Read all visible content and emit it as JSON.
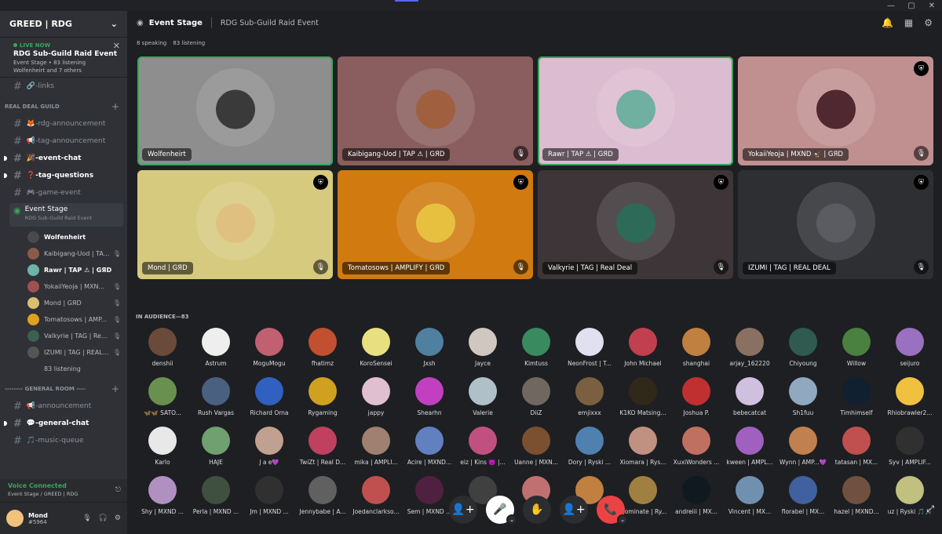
{
  "window": {
    "controls": [
      "—",
      "▢",
      "✕"
    ]
  },
  "guild": {
    "name": "GREED | RDG"
  },
  "live": {
    "tag": "LIVE NOW",
    "title": "RDG Sub-Guild Raid Event",
    "sub": "Event Stage • 83 listening",
    "others": "Wolfenheirt and 7 others"
  },
  "channels_top": [
    {
      "label": "🔗-links"
    }
  ],
  "categories": {
    "real_deal": "REAL DEAL GUILD",
    "general": "-------- GENERAL ROOM ----"
  },
  "channels_rdg": [
    {
      "label": "🦊-rdg-announcement",
      "unread": false
    },
    {
      "label": "📢-tag-announcement",
      "unread": false
    },
    {
      "label": "🎉-event-chat",
      "unread": true
    },
    {
      "label": "❓-tag-questions",
      "unread": true
    },
    {
      "label": "🎮-game-event",
      "unread": false
    }
  ],
  "stage": {
    "name": "Event Stage",
    "sub": "RDG Sub-Guild Raid Event"
  },
  "stage_members": [
    {
      "name": "Wolfenheirt",
      "color": "#4a4a4a",
      "active": true,
      "muted": false
    },
    {
      "name": "Kaibigang-Uod | TA...",
      "color": "#8b5a4a",
      "active": false,
      "muted": true
    },
    {
      "name": "Rawr | TAP ⚠ | GЯD",
      "color": "#6fb3a8",
      "active": true,
      "muted": false
    },
    {
      "name": "YokaiiYeoja | MXN...",
      "color": "#a05050",
      "active": false,
      "muted": true
    },
    {
      "name": "Mond | GЯD",
      "color": "#d8c070",
      "active": false,
      "muted": true
    },
    {
      "name": "Tomatosows | AMP...",
      "color": "#e0a020",
      "active": false,
      "muted": true
    },
    {
      "name": "Valkyrie | TAG | Re...",
      "color": "#3a6050",
      "active": false,
      "muted": true
    },
    {
      "name": "IZUMI | TAG | REAL...",
      "color": "#555",
      "active": false,
      "muted": true
    },
    {
      "name": "83 listening",
      "color": "#2f3136",
      "active": false,
      "muted": false
    }
  ],
  "channels_general": [
    {
      "label": "📢-announcement",
      "unread": false
    },
    {
      "label": "💬-general-chat",
      "unread": true
    },
    {
      "label": "🎵-music-queue",
      "unread": false
    }
  ],
  "voice": {
    "title": "Voice Connected",
    "sub": "Event Stage / GREED | RDG"
  },
  "user": {
    "name": "Mond",
    "disc": "#5964"
  },
  "header": {
    "title": "Event Stage",
    "subtitle": "RDG Sub-Guild Raid Event"
  },
  "stats": {
    "speaking": "8 speaking",
    "listening": "83 listening"
  },
  "speakers": [
    {
      "name": "Wolfenheirt",
      "bg": "#8e8e8e",
      "av": "#3a3a3a",
      "speaking": true,
      "mod": false,
      "muted": false
    },
    {
      "name": "Kaibigang-Uod | TAP ⚠ | GЯD",
      "bg": "#8a5e5e",
      "av": "#a06040",
      "speaking": false,
      "mod": false,
      "muted": true
    },
    {
      "name": "Rawr | TAP ⚠ | GЯD",
      "bg": "#dcbcd0",
      "av": "#70b0a0",
      "speaking": true,
      "mod": false,
      "muted": false
    },
    {
      "name": "YokaiiYeoja | MXND 🦅 | GЯD",
      "bg": "#c09090",
      "av": "#502830",
      "speaking": false,
      "mod": true,
      "muted": true
    },
    {
      "name": "Mond | GЯD",
      "bg": "#d6ca7e",
      "av": "#e0c080",
      "speaking": false,
      "mod": true,
      "muted": true
    },
    {
      "name": "Tomatosows | AMPLIFY | GЯD",
      "bg": "#d07a10",
      "av": "#e8c040",
      "speaking": false,
      "mod": true,
      "muted": true
    },
    {
      "name": "Valkyrie | TAG | Real Deal",
      "bg": "#3d3537",
      "av": "#2e6a58",
      "speaking": false,
      "mod": true,
      "muted": true
    },
    {
      "name": "IZUMI | TAG | REAL DEAL",
      "bg": "#2e2f33",
      "av": "#5a5c62",
      "speaking": false,
      "mod": true,
      "muted": true
    }
  ],
  "audience_title": "IN AUDIENCE—83",
  "audience": [
    {
      "n": "denshii",
      "c": "#6a4a3a"
    },
    {
      "n": "Astrum",
      "c": "#eeeeee"
    },
    {
      "n": "MoguMogu",
      "c": "#c06070"
    },
    {
      "n": "fhatimz",
      "c": "#c05030"
    },
    {
      "n": "KoroSensei",
      "c": "#e8e080"
    },
    {
      "n": "Jxsh",
      "c": "#5080a0"
    },
    {
      "n": "Jayce",
      "c": "#d0c8c0"
    },
    {
      "n": "Kimtuss",
      "c": "#3a8a60"
    },
    {
      "n": "NeonFrost | T...",
      "c": "#e0e0f0"
    },
    {
      "n": "John Michael",
      "c": "#c04050"
    },
    {
      "n": "shanghai",
      "c": "#c08040"
    },
    {
      "n": "arjay_162220",
      "c": "#8a7060"
    },
    {
      "n": "Chiyoung",
      "c": "#305a50"
    },
    {
      "n": "Willow",
      "c": "#4a8040"
    },
    {
      "n": "seijuro",
      "c": "#9a70c0"
    },
    {
      "n": "🦋🦋 SATO...",
      "c": "#6a9050"
    },
    {
      "n": "Rush Vargas",
      "c": "#4a6080"
    },
    {
      "n": "Richard Orna",
      "c": "#3060c0"
    },
    {
      "n": "Rygaming",
      "c": "#d0a020"
    },
    {
      "n": "jappy",
      "c": "#e0c0d0"
    },
    {
      "n": "Shearhn",
      "c": "#c040c0"
    },
    {
      "n": "Valerie",
      "c": "#b0c0c8"
    },
    {
      "n": "DiiZ",
      "c": "#706860"
    },
    {
      "n": "emjixxx",
      "c": "#7a6040"
    },
    {
      "n": "K1KO Matsing...",
      "c": "#302818"
    },
    {
      "n": "Joshua P.",
      "c": "#c03030"
    },
    {
      "n": "bebecatcat",
      "c": "#d0c0e0"
    },
    {
      "n": "Sh1fuu",
      "c": "#90a8c0"
    },
    {
      "n": "Timhimself",
      "c": "#102030"
    },
    {
      "n": "Rhiobrawler2...",
      "c": "#f0c040"
    },
    {
      "n": "Karlo",
      "c": "#e8e8e8"
    },
    {
      "n": "HAJE",
      "c": "#70a070"
    },
    {
      "n": "J a e💜",
      "c": "#c0a090"
    },
    {
      "n": "TwiZt | Real D...",
      "c": "#c04060"
    },
    {
      "n": "mika | AMPLI...",
      "c": "#a08070"
    },
    {
      "n": "Acire | MXND...",
      "c": "#6080c0"
    },
    {
      "n": "eiz | Kins 👿 |...",
      "c": "#c05080"
    },
    {
      "n": "Uanne | MXN...",
      "c": "#7a5030"
    },
    {
      "n": "Dory | Ryski ...",
      "c": "#5080b0"
    },
    {
      "n": "Xiomara | Rys...",
      "c": "#c09080"
    },
    {
      "n": "XuxiWonders ...",
      "c": "#c07060"
    },
    {
      "n": "kween | AMPL...",
      "c": "#a060c0"
    },
    {
      "n": "Wynn | AMP...💜",
      "c": "#c08050"
    },
    {
      "n": "tatasan | MX...",
      "c": "#c05050"
    },
    {
      "n": "Syv | AMPLIF...",
      "c": "#303030"
    },
    {
      "n": "Shy | MXND ...",
      "c": "#b090c0"
    },
    {
      "n": "Perla | MXND ...",
      "c": "#405040"
    },
    {
      "n": "Jm | MXND ...",
      "c": "#303030"
    },
    {
      "n": "Jennybabe | A...",
      "c": "#606060"
    },
    {
      "n": "Joedanclarkso...",
      "c": "#c05050"
    },
    {
      "n": "Sem | MXND ...",
      "c": "#502040"
    },
    {
      "n": "",
      "c": "#404040"
    },
    {
      "n": "",
      "c": "#c07070"
    },
    {
      "n": "",
      "c": "#c08040"
    },
    {
      "n": "...ominate | Ry...",
      "c": "#a08040"
    },
    {
      "n": "andreiii | MX...",
      "c": "#101820"
    },
    {
      "n": "Vincent | MX...",
      "c": "#7090b0"
    },
    {
      "n": "florabel | MX...",
      "c": "#4060a0"
    },
    {
      "n": "hazel | MXND...",
      "c": "#705040"
    },
    {
      "n": "uz | Ryski 🎵🎵",
      "c": "#c0c080"
    }
  ],
  "controls": {
    "invite": "👤+",
    "mute": "🎤",
    "hand": "✋",
    "add": "👤+",
    "leave": "📞"
  }
}
